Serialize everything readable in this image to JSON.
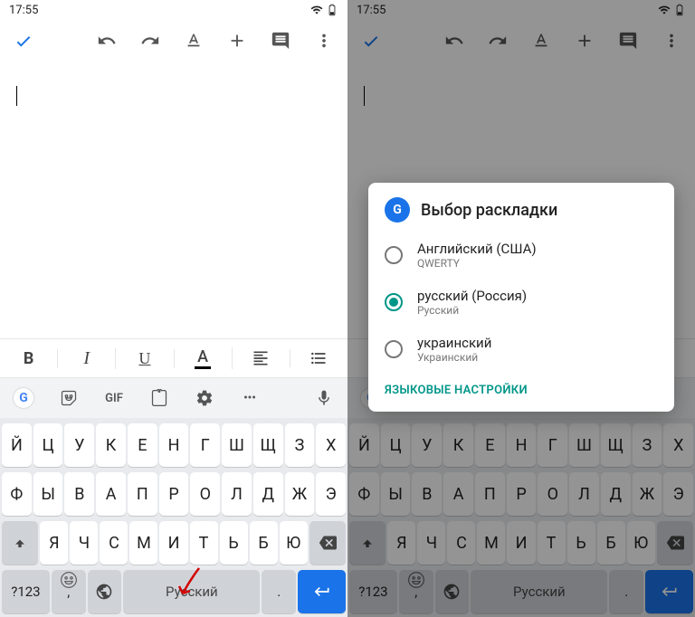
{
  "statusbar": {
    "time": "17:55"
  },
  "appbar": {},
  "format": {
    "bold": "B",
    "italic": "I",
    "underline": "U",
    "color": "A"
  },
  "kbtop": {
    "gif": "GIF",
    "dots": "•••"
  },
  "keyboard": {
    "row1": [
      "Й",
      "Ц",
      "У",
      "К",
      "Е",
      "Н",
      "Г",
      "Ш",
      "Щ",
      "З",
      "Х"
    ],
    "row2": [
      "Ф",
      "Ы",
      "В",
      "А",
      "П",
      "Р",
      "О",
      "Л",
      "Д",
      "Ж",
      "Э"
    ],
    "row3": [
      "Я",
      "Ч",
      "С",
      "М",
      "И",
      "Т",
      "Ь",
      "Б",
      "Ю"
    ],
    "numkey": "?123",
    "comma": ",",
    "space": "Русский",
    "period": "."
  },
  "dialog": {
    "title": "Выбор раскладки",
    "options": [
      {
        "label": "Английский (США)",
        "sub": "QWERTY",
        "selected": false
      },
      {
        "label": "русский (Россия)",
        "sub": "Русский",
        "selected": true
      },
      {
        "label": "украинский",
        "sub": "Украинский",
        "selected": false
      }
    ],
    "link": "ЯЗЫКОВЫЕ НАСТРОЙКИ"
  }
}
